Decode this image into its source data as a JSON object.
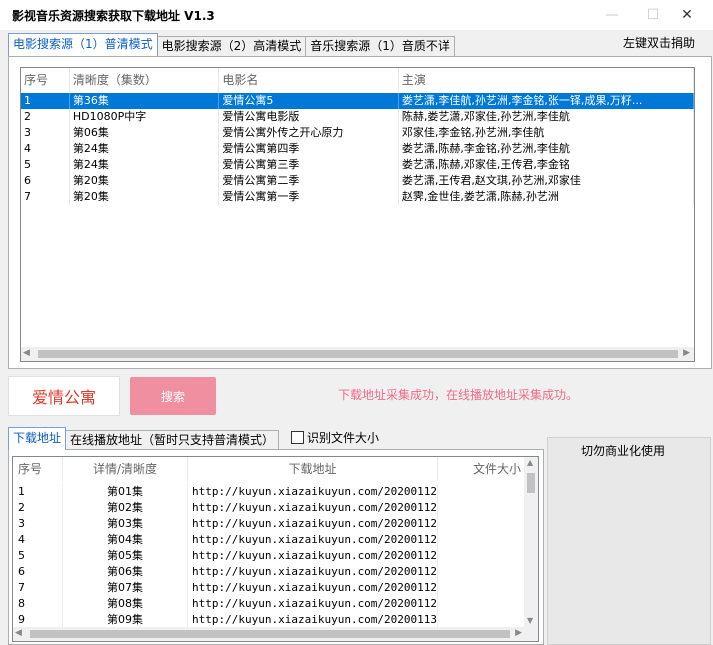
{
  "window": {
    "title": "影视音乐资源搜索获取下载地址  V1.3",
    "controls": {
      "minimize": "—",
      "maximize": "☐",
      "close": "✕"
    }
  },
  "top_tabs": [
    {
      "label": "电影搜索源（1）普清模式",
      "active": true
    },
    {
      "label": "电影搜索源（2）高清模式",
      "active": false
    },
    {
      "label": "音乐搜索源（1）音质不详",
      "active": false
    }
  ],
  "right_hint": "左键双击捐助",
  "movie_list": {
    "columns": [
      "序号",
      "清晰度（集数）",
      "电影名",
      "主演"
    ],
    "rows": [
      {
        "no": "1",
        "quality": "第36集",
        "name": "爱情公寓5",
        "cast": "娄艺潇,李佳航,孙艺洲,李金铭,张一铎,成果,万籽...",
        "selected": true
      },
      {
        "no": "2",
        "quality": "HD1080P中字",
        "name": "爱情公寓电影版",
        "cast": "陈赫,娄艺潇,邓家佳,孙艺洲,李佳航",
        "selected": false
      },
      {
        "no": "3",
        "quality": "第06集",
        "name": "爱情公寓外传之开心原力",
        "cast": "邓家佳,李金铭,孙艺洲,李佳航",
        "selected": false
      },
      {
        "no": "4",
        "quality": "第24集",
        "name": "爱情公寓第四季",
        "cast": "娄艺潇,陈赫,李金铭,孙艺洲,李佳航",
        "selected": false
      },
      {
        "no": "5",
        "quality": "第24集",
        "name": "爱情公寓第三季",
        "cast": "娄艺潇,陈赫,邓家佳,王传君,李金铭",
        "selected": false
      },
      {
        "no": "6",
        "quality": "第20集",
        "name": "爱情公寓第二季",
        "cast": "娄艺潇,王传君,赵文琪,孙艺洲,邓家佳",
        "selected": false
      },
      {
        "no": "7",
        "quality": "第20集",
        "name": "爱情公寓第一季",
        "cast": "赵霁,金世佳,娄艺潇,陈赫,孙艺洲",
        "selected": false
      }
    ]
  },
  "search": {
    "keyword": "爱情公寓",
    "button_label": "搜索",
    "status_message": "下载地址采集成功，在线播放地址采集成功。"
  },
  "bottom_tabs": [
    {
      "label": "下载地址",
      "active": true
    },
    {
      "label": "在线播放地址（暂时只支持普清模式）",
      "active": false
    }
  ],
  "file_size_checkbox": {
    "label": "识别文件大小",
    "checked": false
  },
  "download_list": {
    "columns": [
      "序号",
      "详情/清晰度",
      "下载地址",
      "文件大小"
    ],
    "rows": [
      {
        "no": "1",
        "detail": "第01集",
        "url": "http://kuyun.xiazaikuyun.com/20200112...",
        "size": ""
      },
      {
        "no": "2",
        "detail": "第02集",
        "url": "http://kuyun.xiazaikuyun.com/20200112...",
        "size": ""
      },
      {
        "no": "3",
        "detail": "第03集",
        "url": "http://kuyun.xiazaikuyun.com/20200112...",
        "size": ""
      },
      {
        "no": "4",
        "detail": "第04集",
        "url": "http://kuyun.xiazaikuyun.com/20200112...",
        "size": ""
      },
      {
        "no": "5",
        "detail": "第05集",
        "url": "http://kuyun.xiazaikuyun.com/20200112...",
        "size": ""
      },
      {
        "no": "6",
        "detail": "第06集",
        "url": "http://kuyun.xiazaikuyun.com/20200112...",
        "size": ""
      },
      {
        "no": "7",
        "detail": "第07集",
        "url": "http://kuyun.xiazaikuyun.com/20200112...",
        "size": ""
      },
      {
        "no": "8",
        "detail": "第08集",
        "url": "http://kuyun.xiazaikuyun.com/20200112...",
        "size": ""
      },
      {
        "no": "9",
        "detail": "第09集",
        "url": "http://kuyun.xiazaikuyun.com/20200113...",
        "size": ""
      }
    ]
  },
  "side_panel": {
    "label": "切勿商业化使用"
  },
  "colors": {
    "accent_blue": "#0078d7",
    "keyword_red": "#e03a2a",
    "search_pink": "#f08fa0",
    "status_pink": "#f06c86"
  }
}
